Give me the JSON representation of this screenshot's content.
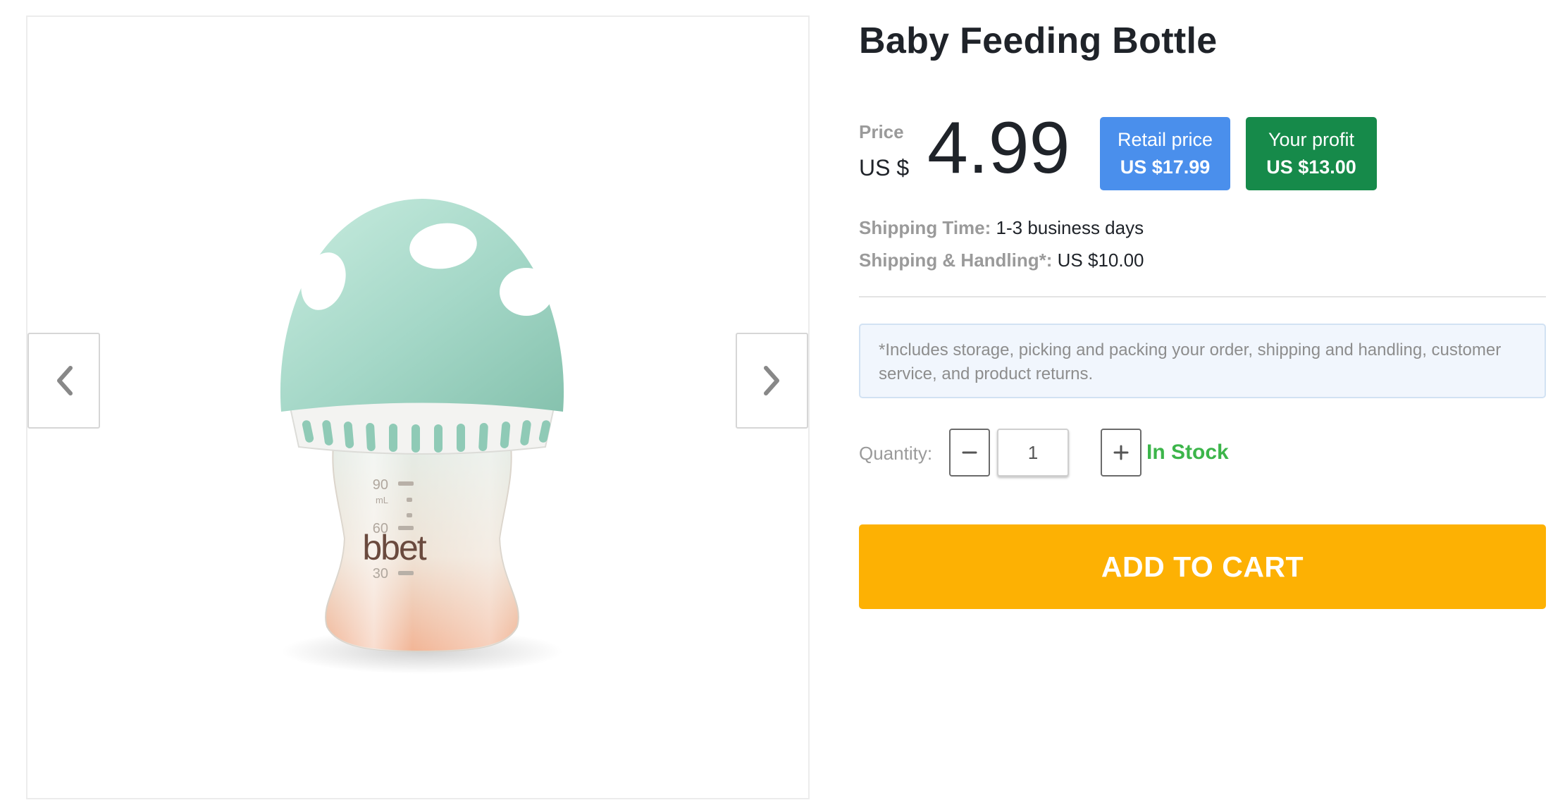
{
  "product": {
    "title": "Baby Feeding Bottle",
    "image_alt": "Mint green mushroom-shaped baby bottle",
    "bottle_markings": [
      "90",
      "mL",
      "60",
      "30"
    ],
    "bottle_logo": "bbet"
  },
  "gallery": {
    "prev_icon": "chevron-left-icon",
    "next_icon": "chevron-right-icon"
  },
  "price": {
    "label": "Price",
    "currency": "US $",
    "value": "4.99"
  },
  "badges": {
    "retail": {
      "label": "Retail price",
      "value": "US $17.99"
    },
    "profit": {
      "label": "Your profit",
      "value": "US $13.00"
    }
  },
  "shipping": {
    "time_label": "Shipping Time:",
    "time_value": "1-3 business days",
    "handling_label": "Shipping & Handling*:",
    "handling_value": "US $10.00"
  },
  "note": "*Includes storage, picking and packing your order, shipping and handling, customer service, and product returns.",
  "quantity": {
    "label": "Quantity:",
    "value": "1",
    "minus_icon": "minus-icon",
    "plus_icon": "plus-icon"
  },
  "stock_status": "In Stock",
  "cta": {
    "label": "ADD TO CART"
  },
  "colors": {
    "retail_badge": "#4a8fec",
    "profit_badge": "#168a4a",
    "in_stock": "#3cb54a",
    "add_to_cart": "#fdb103",
    "note_bg": "#f1f6fd",
    "bottle_cap": "#a6d8c9"
  }
}
